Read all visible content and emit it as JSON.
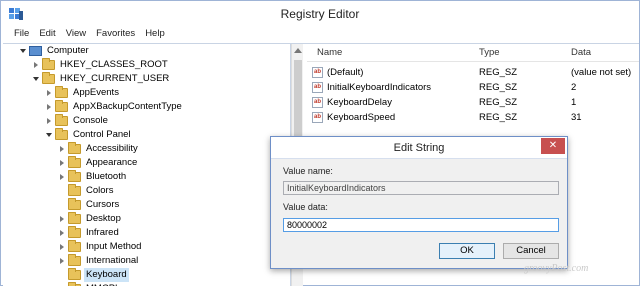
{
  "window": {
    "title": "Registry Editor"
  },
  "menu": [
    "File",
    "Edit",
    "View",
    "Favorites",
    "Help"
  ],
  "tree": [
    {
      "label": "Computer",
      "indent": 0,
      "state": "expanded",
      "icon": "computer-icon"
    },
    {
      "label": "HKEY_CLASSES_ROOT",
      "indent": 1,
      "state": "collapsed",
      "icon": "folder-icon"
    },
    {
      "label": "HKEY_CURRENT_USER",
      "indent": 1,
      "state": "expanded",
      "icon": "folder-icon"
    },
    {
      "label": "AppEvents",
      "indent": 2,
      "state": "collapsed",
      "icon": "folder-icon"
    },
    {
      "label": "AppXBackupContentType",
      "indent": 2,
      "state": "collapsed",
      "icon": "folder-icon"
    },
    {
      "label": "Console",
      "indent": 2,
      "state": "collapsed",
      "icon": "folder-icon"
    },
    {
      "label": "Control Panel",
      "indent": 2,
      "state": "expanded",
      "icon": "folder-icon"
    },
    {
      "label": "Accessibility",
      "indent": 3,
      "state": "collapsed",
      "icon": "folder-icon"
    },
    {
      "label": "Appearance",
      "indent": 3,
      "state": "collapsed",
      "icon": "folder-icon"
    },
    {
      "label": "Bluetooth",
      "indent": 3,
      "state": "collapsed",
      "icon": "folder-icon"
    },
    {
      "label": "Colors",
      "indent": 3,
      "state": "none",
      "icon": "folder-icon"
    },
    {
      "label": "Cursors",
      "indent": 3,
      "state": "none",
      "icon": "folder-icon"
    },
    {
      "label": "Desktop",
      "indent": 3,
      "state": "collapsed",
      "icon": "folder-icon"
    },
    {
      "label": "Infrared",
      "indent": 3,
      "state": "collapsed",
      "icon": "folder-icon"
    },
    {
      "label": "Input Method",
      "indent": 3,
      "state": "collapsed",
      "icon": "folder-icon"
    },
    {
      "label": "International",
      "indent": 3,
      "state": "collapsed",
      "icon": "folder-icon"
    },
    {
      "label": "Keyboard",
      "indent": 3,
      "state": "none",
      "icon": "folder-icon",
      "selected": true
    },
    {
      "label": "MMCPL",
      "indent": 3,
      "state": "none",
      "icon": "folder-icon"
    }
  ],
  "list": {
    "headers": {
      "name": "Name",
      "type": "Type",
      "data": "Data"
    },
    "rows": [
      {
        "name": "(Default)",
        "type": "REG_SZ",
        "data": "(value not set)"
      },
      {
        "name": "InitialKeyboardIndicators",
        "type": "REG_SZ",
        "data": "2"
      },
      {
        "name": "KeyboardDelay",
        "type": "REG_SZ",
        "data": "1"
      },
      {
        "name": "KeyboardSpeed",
        "type": "REG_SZ",
        "data": "31"
      }
    ]
  },
  "dialog": {
    "title": "Edit String",
    "value_name_label": "Value name:",
    "value_name": "InitialKeyboardIndicators",
    "value_data_label": "Value data:",
    "value_data": "80000002",
    "ok_label": "OK",
    "cancel_label": "Cancel",
    "close_glyph": "✕"
  },
  "watermark": "groovyPost.com"
}
